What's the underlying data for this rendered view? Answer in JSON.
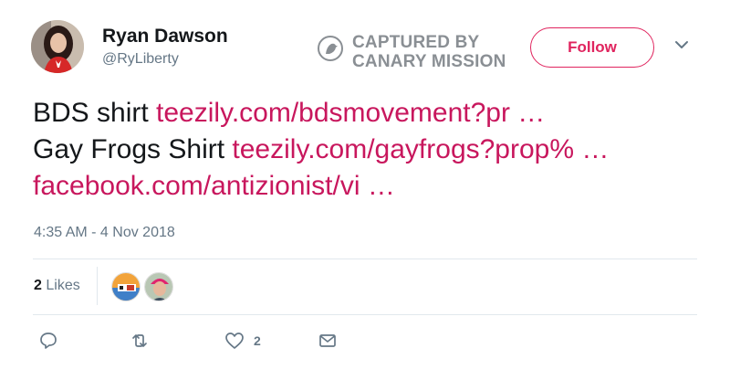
{
  "user": {
    "display_name": "Ryan Dawson",
    "handle": "@RyLiberty",
    "avatar_icon": "profile-photo"
  },
  "watermark": {
    "line1": "CAPTURED BY",
    "line2": "CANARY MISSION",
    "icon": "canary-bird-icon"
  },
  "follow": {
    "label": "Follow",
    "color": "#e0245e"
  },
  "tweet": {
    "part1": "BDS shirt ",
    "link1": "teezily.com/bdsmovement?pr …",
    "part2": "Gay Frogs Shirt ",
    "link2": "teezily.com/gayfrogs?prop% …",
    "link3": "facebook.com/antizionist/vi …",
    "link_color": "#c8175d"
  },
  "timestamp": "4:35 AM - 4 Nov 2018",
  "stats": {
    "likes_count": "2",
    "likes_label": "Likes"
  },
  "actions": {
    "reply_icon": "reply-icon",
    "retweet_icon": "retweet-icon",
    "like_icon": "heart-icon",
    "like_count": "2",
    "dm_icon": "envelope-icon"
  },
  "colors": {
    "text": "#14171a",
    "secondary": "#657786",
    "border": "#e1e8ed"
  }
}
